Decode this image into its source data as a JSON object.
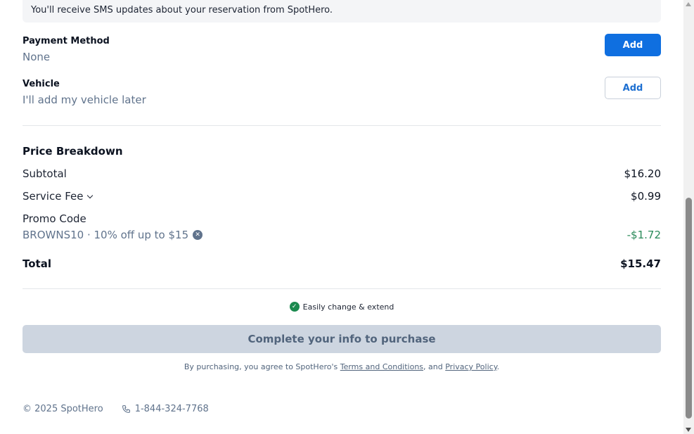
{
  "sms_banner": "You'll receive SMS updates about your reservation from SpotHero.",
  "payment": {
    "label": "Payment Method",
    "value": "None",
    "button": "Add"
  },
  "vehicle": {
    "label": "Vehicle",
    "value": "I'll add my vehicle later",
    "button": "Add"
  },
  "price": {
    "title": "Price Breakdown",
    "subtotal_label": "Subtotal",
    "subtotal_value": "$16.20",
    "fee_label": "Service Fee",
    "fee_value": "$0.99",
    "promo_label": "Promo Code",
    "promo_code": "BROWNS10 · 10% off up to $15",
    "promo_value": "-$1.72",
    "total_label": "Total",
    "total_value": "$15.47"
  },
  "easy_text": "Easily change & extend",
  "purchase_button": "Complete your info to purchase",
  "legal": {
    "prefix": "By purchasing, you agree to SpotHero's ",
    "terms": "Terms and Conditions",
    "middle": ", and ",
    "privacy": "Privacy Policy",
    "suffix": "."
  },
  "footer": {
    "copyright": "© 2025 SpotHero",
    "phone": "1-844-324-7768"
  },
  "colors": {
    "primary": "#0f6fe0",
    "muted": "#60738c",
    "success": "#1b8a4f",
    "promo": "#2a8a5a",
    "disabled_button": "#cdd5e0"
  }
}
